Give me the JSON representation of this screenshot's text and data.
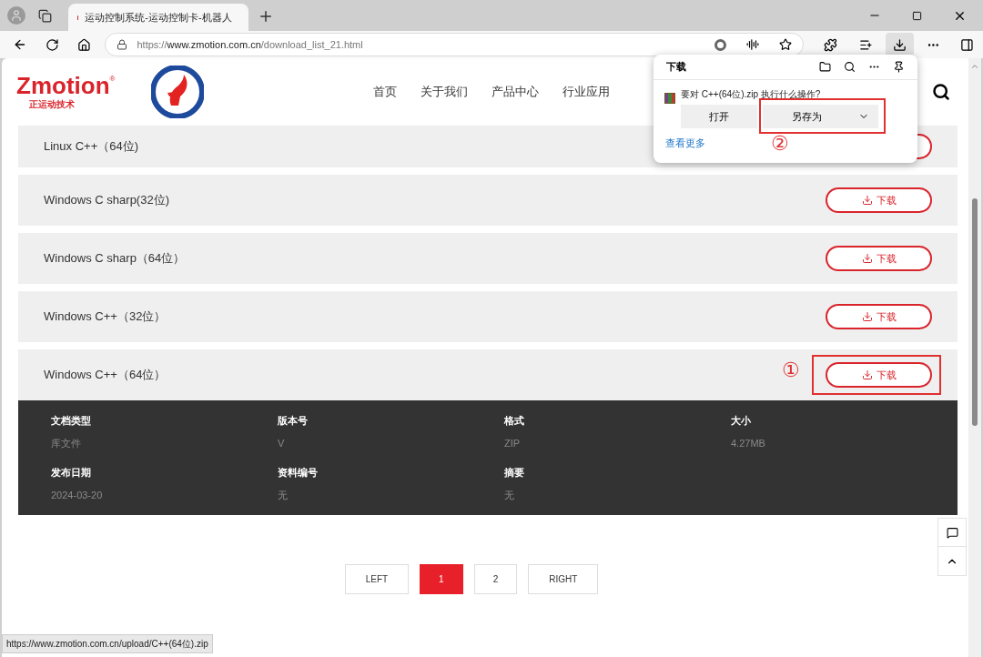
{
  "browser": {
    "tabs": [
      {
        "title": "运动控制系统-运动控制卡-机器人",
        "selected": true
      }
    ],
    "address": {
      "scheme": "https://",
      "host": "www.zmotion.com.cn",
      "path": "/download_list_21.html"
    },
    "status_url": "https://www.zmotion.com.cn/upload/C++(64位).zip"
  },
  "header": {
    "logo": {
      "brand": "Zmotion",
      "mark": "®",
      "subtitle": "正运动技术"
    },
    "nav": [
      {
        "label": "首页"
      },
      {
        "label": "关于我们"
      },
      {
        "label": "产品中心"
      },
      {
        "label": "行业应用"
      }
    ]
  },
  "downloads": [
    {
      "name": "Linux C++（64位)"
    },
    {
      "name": "Windows C sharp(32位)",
      "button": "下载"
    },
    {
      "name": "Windows C sharp（64位）",
      "button": "下载"
    },
    {
      "name": "Windows C++（32位）",
      "button": "下载"
    },
    {
      "name": "Windows C++（64位）",
      "button": "下载",
      "annotation": "①",
      "details": [
        {
          "label": "文档类型",
          "value": "库文件"
        },
        {
          "label": "版本号",
          "value": "V"
        },
        {
          "label": "格式",
          "value": "ZIP"
        },
        {
          "label": "大小",
          "value": "4.27MB"
        },
        {
          "label": "发布日期",
          "value": "2024-03-20"
        },
        {
          "label": "资料编号",
          "value": "无"
        },
        {
          "label": "摘要",
          "value": "无"
        }
      ]
    }
  ],
  "pagination": [
    {
      "label": "LEFT",
      "selected": false
    },
    {
      "label": "1",
      "selected": true
    },
    {
      "label": "2",
      "selected": false
    },
    {
      "label": "RIGHT",
      "selected": false
    }
  ],
  "download_popup": {
    "title": "下载",
    "question": "要对 C++(64位).zip 执行什么操作?",
    "open_button": "打开",
    "save_as_button": "另存为",
    "annotation": "②",
    "more_link": "查看更多"
  }
}
